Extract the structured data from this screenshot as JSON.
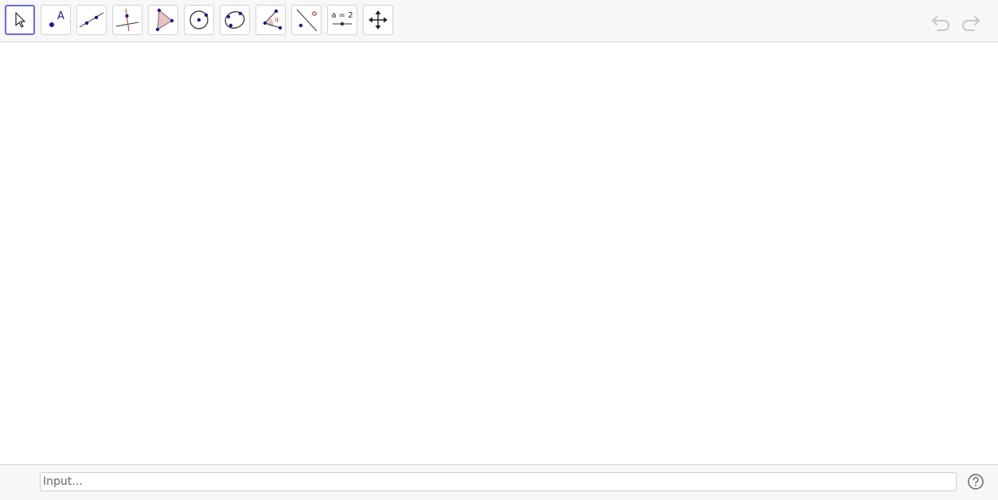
{
  "toolbar": {
    "tools": [
      {
        "name": "move-tool",
        "icon": "arrow-cursor-icon",
        "selected": true
      },
      {
        "name": "point-tool",
        "icon": "point-icon",
        "label": "A"
      },
      {
        "name": "line-tool",
        "icon": "line-through-points-icon"
      },
      {
        "name": "perpendicular-line-tool",
        "icon": "perpendicular-line-icon"
      },
      {
        "name": "polygon-tool",
        "icon": "polygon-icon"
      },
      {
        "name": "circle-tool",
        "icon": "circle-center-point-icon"
      },
      {
        "name": "conic-tool",
        "icon": "conic-five-points-icon"
      },
      {
        "name": "angle-tool",
        "icon": "angle-icon",
        "label": "α"
      },
      {
        "name": "reflect-tool",
        "icon": "reflect-about-line-icon"
      },
      {
        "name": "slider-tool",
        "icon": "slider-icon",
        "label": "a = 2"
      },
      {
        "name": "move-graphics-view-tool",
        "icon": "move-arrows-icon"
      }
    ],
    "undo_icon": "undo-icon",
    "redo_icon": "redo-icon"
  },
  "input": {
    "placeholder": "Input…",
    "value": ""
  },
  "help_icon": "help-circle-icon",
  "colors": {
    "selected_border": "#6b6bd8",
    "point_blue": "#1a1a99",
    "accent_red": "#c0392b",
    "polygon_fill": "#e5c4c4",
    "disabled_gray": "#c8c8c8"
  }
}
